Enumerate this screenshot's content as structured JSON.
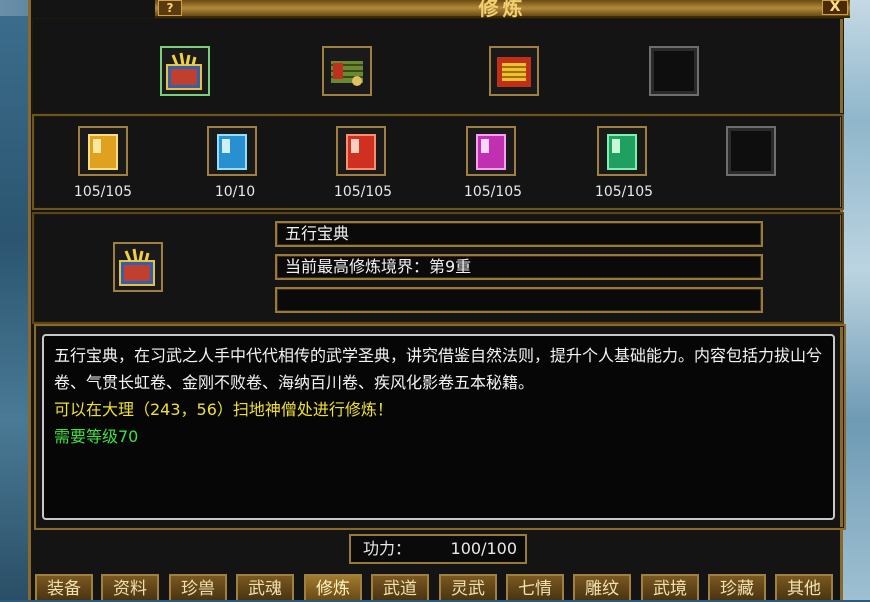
{
  "window": {
    "title": "修炼",
    "help_label": "?",
    "close_label": "X"
  },
  "top_slots": [
    {
      "icon": "scroll-book-icon",
      "selected": true
    },
    {
      "icon": "bamboo-scroll-icon",
      "selected": false
    },
    {
      "icon": "golden-scroll-icon",
      "selected": false
    },
    {
      "icon": "empty-slot",
      "selected": false
    }
  ],
  "books": [
    {
      "icon": "yellow-book-icon",
      "count": "105/105"
    },
    {
      "icon": "blue-book-icon",
      "count": "10/10"
    },
    {
      "icon": "red-book-icon",
      "count": "105/105"
    },
    {
      "icon": "purple-book-icon",
      "count": "105/105"
    },
    {
      "icon": "green-book-icon",
      "count": "105/105"
    },
    {
      "icon": "empty-slot",
      "count": ""
    }
  ],
  "detail": {
    "name": "五行宝典",
    "level": "当前最高修炼境界：第9重",
    "extra": ""
  },
  "description": {
    "line1": "五行宝典，在习武之人手中代代相传的武学圣典，讲究借鉴自然法则，提升个人基础能力。内容包括力拔山兮卷、气贯长虹卷、金刚不败卷、海纳百川卷、疾风化影卷五本秘籍。",
    "line2": "可以在大理（243，56）扫地神僧处进行修炼！",
    "line3": "需要等级70"
  },
  "power": {
    "label": "功力：",
    "value": "100/100"
  },
  "tabs": [
    "装备",
    "资料",
    "珍兽",
    "武魂",
    "修炼",
    "武道",
    "灵武",
    "七情",
    "雕纹",
    "武境",
    "珍藏",
    "其他"
  ],
  "active_tab": "修炼",
  "colors": {
    "frame": "#9a7a3a",
    "text_yellow": "#f0e030",
    "text_green": "#40e040"
  }
}
